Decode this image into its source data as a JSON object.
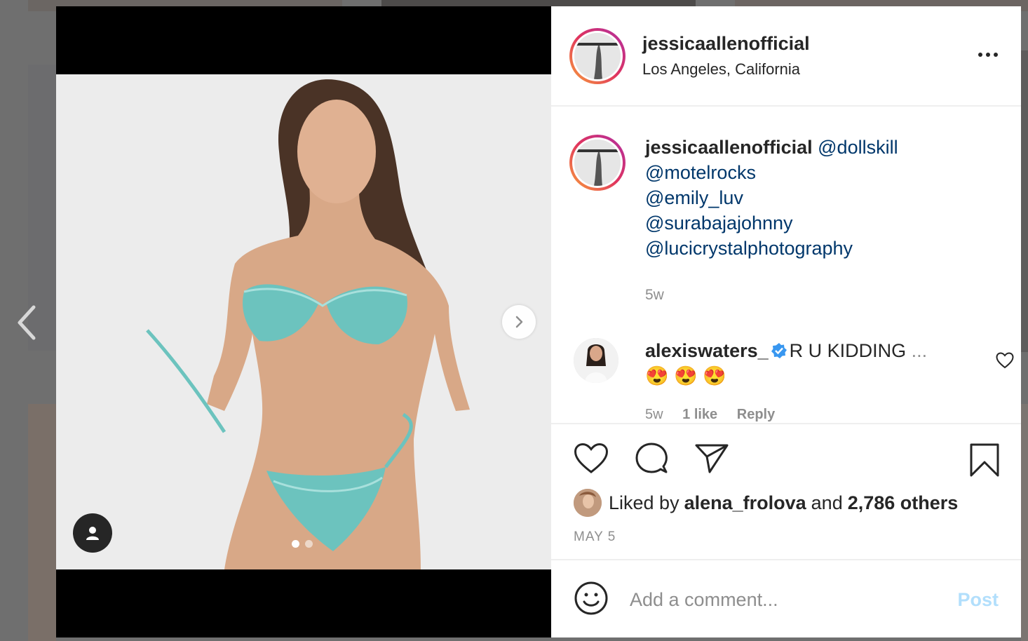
{
  "post": {
    "username": "jessicaallenofficial",
    "location": "Los Angeles, California",
    "caption_mentions": [
      "@dollskill",
      "@motelrocks",
      "@emily_luv",
      "@surabajajohnny",
      "@lucicrystalphotography"
    ],
    "age": "5w",
    "date": "MAY 5",
    "carousel": {
      "total": 2,
      "current": 1
    }
  },
  "comment": {
    "username": "alexiswaters_",
    "text": "R U KIDDING",
    "emojis": "😍 😍 😍",
    "ellipsis": "...",
    "age": "5w",
    "likes": "1 like",
    "reply": "Reply"
  },
  "likes": {
    "prefix": "Liked by",
    "user": "alena_frolova",
    "joiner": "and",
    "others": "2,786 others"
  },
  "add_comment": {
    "placeholder": "Add a comment...",
    "post_label": "Post"
  },
  "colors": {
    "link": "#00376b",
    "text": "#262626",
    "muted": "#8e8e8e",
    "post_disabled": "#b2dffc",
    "verified": "#3897f0"
  }
}
